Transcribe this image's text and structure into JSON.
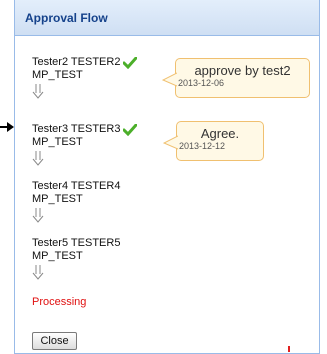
{
  "dialog": {
    "title": "Approval Flow"
  },
  "steps": [
    {
      "name": "Tester2 TESTER2",
      "group": "MP_TEST",
      "approved": true,
      "comment": {
        "text": "approve by test2",
        "date": "2013-12-06"
      }
    },
    {
      "name": "Tester3 TESTER3",
      "group": "MP_TEST",
      "approved": true,
      "comment": {
        "text": "Agree.",
        "date": "2013-12-12"
      }
    },
    {
      "name": "Tester4 TESTER4",
      "group": "MP_TEST",
      "approved": false
    },
    {
      "name": "Tester5 TESTER5",
      "group": "MP_TEST",
      "approved": false
    }
  ],
  "status": {
    "text": "Processing",
    "color": "#e01010"
  },
  "buttons": {
    "close_label": "Close"
  },
  "colors": {
    "title_text": "#15428b",
    "border": "#99bbe8",
    "check": "#4caf2a",
    "comment_bg": "#fff9e6",
    "comment_border": "#f0c070"
  }
}
